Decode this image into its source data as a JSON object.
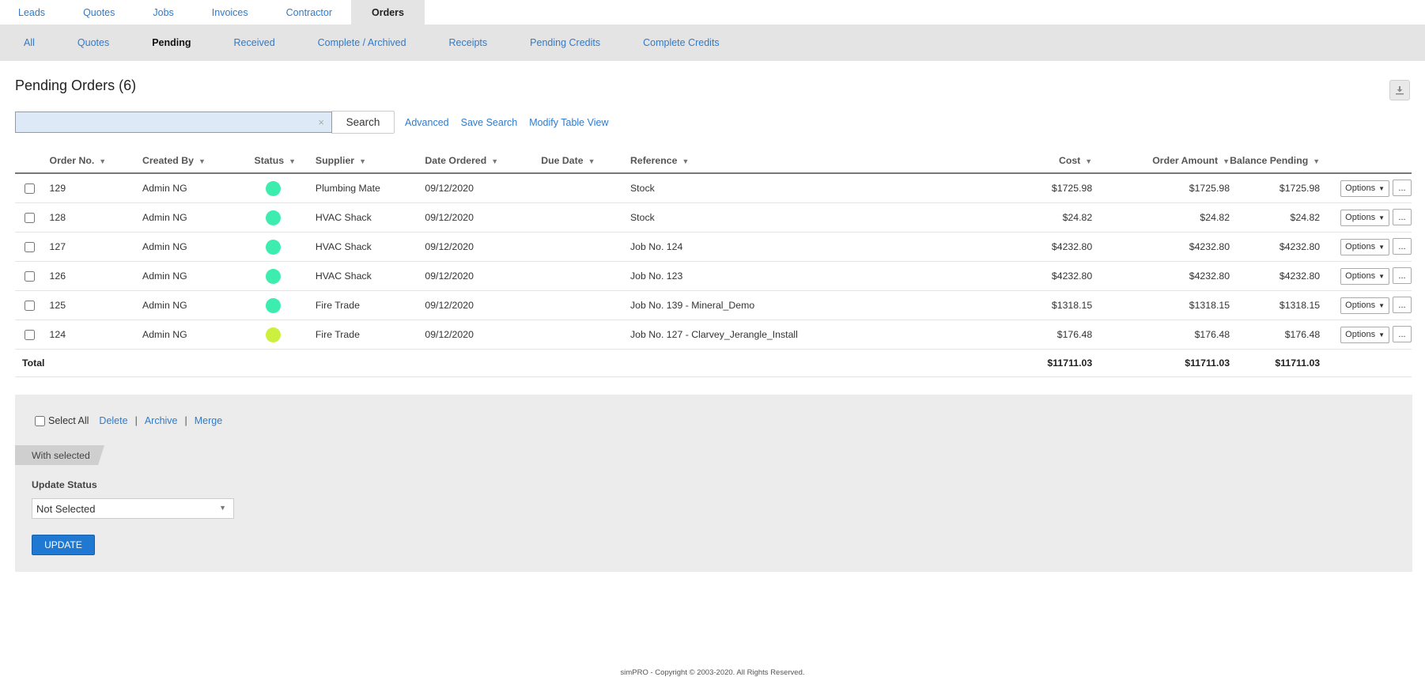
{
  "top_tabs": [
    {
      "label": "Leads"
    },
    {
      "label": "Quotes"
    },
    {
      "label": "Jobs"
    },
    {
      "label": "Invoices"
    },
    {
      "label": "Contractor"
    },
    {
      "label": "Orders",
      "active": true
    }
  ],
  "sub_tabs": [
    {
      "label": "All"
    },
    {
      "label": "Quotes"
    },
    {
      "label": "Pending",
      "active": true
    },
    {
      "label": "Received"
    },
    {
      "label": "Complete / Archived"
    },
    {
      "label": "Receipts"
    },
    {
      "label": "Pending Credits"
    },
    {
      "label": "Complete Credits"
    }
  ],
  "page": {
    "title": "Pending Orders (6)",
    "export_icon": "download-icon"
  },
  "search": {
    "value": "",
    "clear_glyph": "×",
    "button_label": "Search",
    "links": [
      "Advanced",
      "Save Search",
      "Modify Table View"
    ]
  },
  "table": {
    "columns": [
      "Order No.",
      "Created By",
      "Status",
      "Supplier",
      "Date Ordered",
      "Due Date",
      "Reference",
      "Cost",
      "Order Amount",
      "Balance Pending"
    ],
    "rows": [
      {
        "order_no": "129",
        "created_by": "Admin NG",
        "status_color": "#3dedb0",
        "supplier": "Plumbing Mate",
        "date_ordered": "09/12/2020",
        "due_date": "",
        "reference": "Stock",
        "cost": "$1725.98",
        "order_amount": "$1725.98",
        "balance_pending": "$1725.98"
      },
      {
        "order_no": "128",
        "created_by": "Admin NG",
        "status_color": "#3dedb0",
        "supplier": "HVAC Shack",
        "date_ordered": "09/12/2020",
        "due_date": "",
        "reference": "Stock",
        "cost": "$24.82",
        "order_amount": "$24.82",
        "balance_pending": "$24.82"
      },
      {
        "order_no": "127",
        "created_by": "Admin NG",
        "status_color": "#3dedb0",
        "supplier": "HVAC Shack",
        "date_ordered": "09/12/2020",
        "due_date": "",
        "reference": "Job No. 124",
        "cost": "$4232.80",
        "order_amount": "$4232.80",
        "balance_pending": "$4232.80"
      },
      {
        "order_no": "126",
        "created_by": "Admin NG",
        "status_color": "#3dedb0",
        "supplier": "HVAC Shack",
        "date_ordered": "09/12/2020",
        "due_date": "",
        "reference": "Job No. 123",
        "cost": "$4232.80",
        "order_amount": "$4232.80",
        "balance_pending": "$4232.80"
      },
      {
        "order_no": "125",
        "created_by": "Admin NG",
        "status_color": "#3dedb0",
        "supplier": "Fire Trade",
        "date_ordered": "09/12/2020",
        "due_date": "",
        "reference": "Job No. 139 - Mineral_Demo",
        "cost": "$1318.15",
        "order_amount": "$1318.15",
        "balance_pending": "$1318.15"
      },
      {
        "order_no": "124",
        "created_by": "Admin NG",
        "status_color": "#cdf03f",
        "supplier": "Fire Trade",
        "date_ordered": "09/12/2020",
        "due_date": "",
        "reference": "Job No. 127 - Clarvey_Jerangle_Install",
        "cost": "$176.48",
        "order_amount": "$176.48",
        "balance_pending": "$176.48"
      }
    ],
    "row_options_label": "Options",
    "row_more_label": "...",
    "total": {
      "label": "Total",
      "cost": "$11711.03",
      "order_amount": "$11711.03",
      "balance_pending": "$11711.03"
    }
  },
  "bulk": {
    "select_all_label": "Select All",
    "actions": [
      "Delete",
      "Archive",
      "Merge"
    ],
    "with_selected_label": "With selected",
    "update_status_label": "Update Status",
    "status_value": "Not Selected",
    "update_button": "UPDATE"
  },
  "footer": {
    "text": "simPRO - Copyright © 2003-2020. All Rights Reserved."
  }
}
